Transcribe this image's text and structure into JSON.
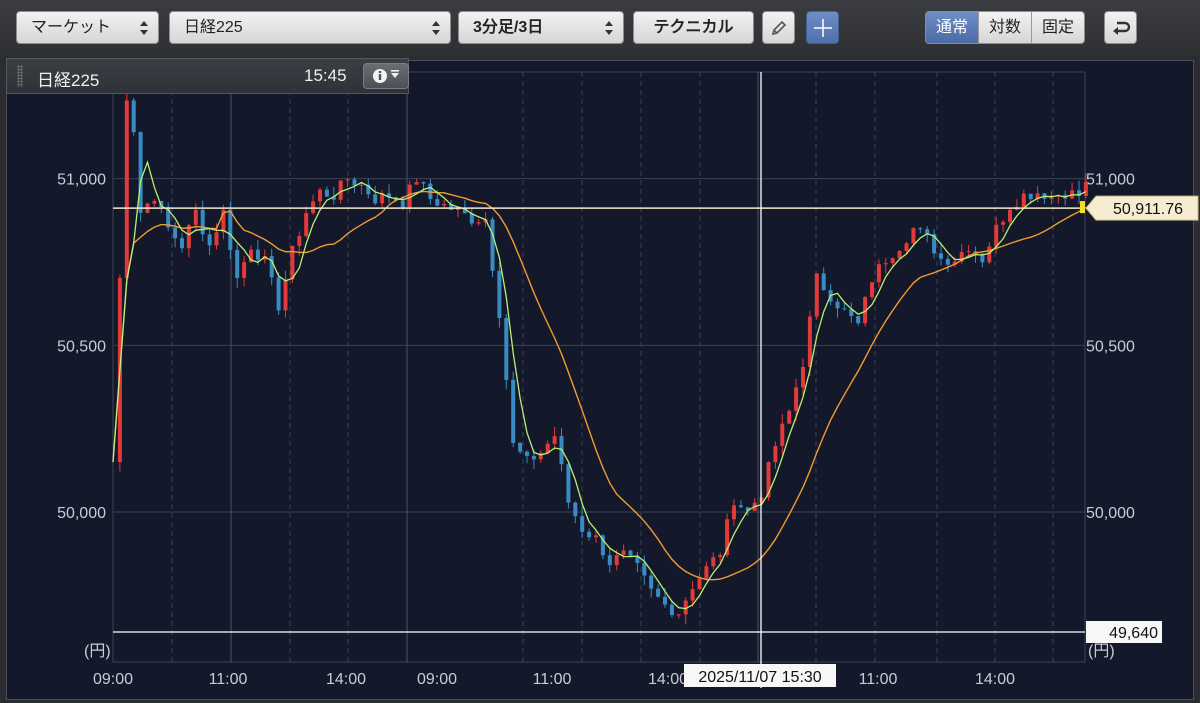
{
  "toolbar": {
    "market_label": "マーケット",
    "index_label": "日経225",
    "interval_label": "3分足/3日",
    "technical_label": "テクニカル",
    "scale_options": [
      "通常",
      "対数",
      "固定"
    ],
    "selected_scale": "通常"
  },
  "info": {
    "name": "日経225",
    "time": "15:45"
  },
  "colors": {
    "up": "#e23a3a",
    "down": "#3a8bc2",
    "ma_short": "#b8f070",
    "ma_long": "#f39a32",
    "background": "#13192a",
    "crosshair": "#ffffff",
    "accent": "#5878b8"
  },
  "chart_data": {
    "type": "candlestick",
    "unit_label": "(円)",
    "y_ticks": [
      50000,
      50500,
      51000
    ],
    "y_tick_labels": [
      "50,000",
      "50,500",
      "51,000"
    ],
    "ylim": [
      49550,
      51320
    ],
    "x_tick_labels": [
      "09:00",
      "11:00",
      "14:00",
      "09:00",
      "11:00",
      "14:00",
      "11:00",
      "14:00"
    ],
    "last_price_label": "50,911.76",
    "last_price": 50911.76,
    "crosshair_price_label": "49,640",
    "crosshair_price": 49640,
    "crosshair_time_label": "2025/11/07 15:30",
    "grid": true,
    "price_path": [
      [
        0,
        50150
      ],
      [
        2,
        51250
      ],
      [
        3,
        51150
      ],
      [
        4,
        50900
      ],
      [
        6,
        50950
      ],
      [
        8,
        50850
      ],
      [
        10,
        50800
      ],
      [
        12,
        50900
      ],
      [
        14,
        50800
      ],
      [
        16,
        50900
      ],
      [
        18,
        50700
      ],
      [
        20,
        50800
      ],
      [
        22,
        50750
      ],
      [
        24,
        50620
      ],
      [
        26,
        50780
      ],
      [
        28,
        50900
      ],
      [
        30,
        50960
      ],
      [
        32,
        50950
      ],
      [
        34,
        51000
      ],
      [
        36,
        50980
      ],
      [
        38,
        50940
      ],
      [
        40,
        50950
      ],
      [
        42,
        50930
      ],
      [
        44,
        51000
      ],
      [
        46,
        50940
      ],
      [
        48,
        50920
      ],
      [
        50,
        50900
      ],
      [
        52,
        50880
      ],
      [
        54,
        50880
      ],
      [
        56,
        50600
      ],
      [
        58,
        50200
      ],
      [
        60,
        50150
      ],
      [
        62,
        50180
      ],
      [
        64,
        50230
      ],
      [
        66,
        50030
      ],
      [
        68,
        49950
      ],
      [
        70,
        49920
      ],
      [
        72,
        49850
      ],
      [
        74,
        49870
      ],
      [
        76,
        49830
      ],
      [
        78,
        49760
      ],
      [
        80,
        49720
      ],
      [
        82,
        49700
      ],
      [
        84,
        49780
      ],
      [
        86,
        49830
      ],
      [
        88,
        49880
      ],
      [
        90,
        50040
      ],
      [
        92,
        50000
      ],
      [
        94,
        50060
      ],
      [
        96,
        50200
      ],
      [
        98,
        50300
      ],
      [
        100,
        50450
      ],
      [
        102,
        50700
      ],
      [
        104,
        50650
      ],
      [
        106,
        50600
      ],
      [
        108,
        50560
      ],
      [
        110,
        50700
      ],
      [
        112,
        50760
      ],
      [
        114,
        50800
      ],
      [
        116,
        50850
      ],
      [
        118,
        50820
      ],
      [
        120,
        50760
      ],
      [
        122,
        50760
      ],
      [
        124,
        50800
      ],
      [
        126,
        50760
      ],
      [
        128,
        50850
      ],
      [
        130,
        50920
      ],
      [
        132,
        50950
      ],
      [
        134,
        50960
      ],
      [
        136,
        50950
      ],
      [
        138,
        50960
      ],
      [
        140,
        50950
      ],
      [
        141,
        50980
      ]
    ]
  }
}
